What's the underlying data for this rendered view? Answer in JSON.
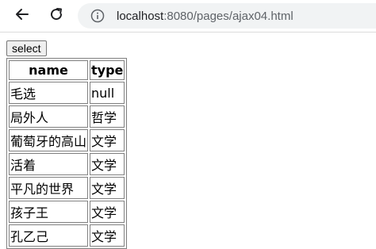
{
  "browser": {
    "url_host": "localhost",
    "url_path": ":8080/pages/ajax04.html"
  },
  "page": {
    "select_label": "select",
    "table": {
      "headers": [
        "name",
        "type"
      ],
      "rows": [
        [
          "毛选",
          "null"
        ],
        [
          "局外人",
          "哲学"
        ],
        [
          "葡萄牙的高山",
          "文学"
        ],
        [
          "活着",
          "文学"
        ],
        [
          "平凡的世界",
          "文学"
        ],
        [
          "孩子王",
          "文学"
        ],
        [
          "孔乙己",
          "文学"
        ]
      ]
    }
  }
}
